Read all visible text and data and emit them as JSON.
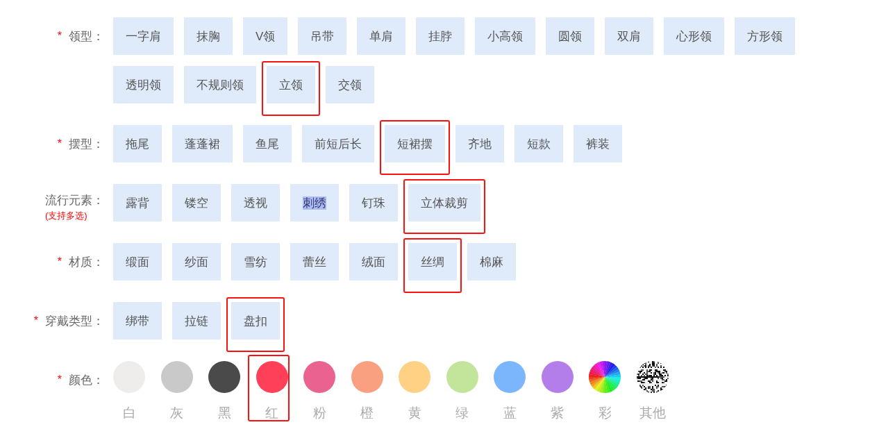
{
  "sections": [
    {
      "kind": "options",
      "required_mark": "*",
      "label": "领型：",
      "options": [
        {
          "text": "一字肩",
          "marked": false,
          "highlighted": false
        },
        {
          "text": "抹胸",
          "marked": false,
          "highlighted": false
        },
        {
          "text": "V领",
          "marked": false,
          "highlighted": false
        },
        {
          "text": "吊带",
          "marked": false,
          "highlighted": false
        },
        {
          "text": "单肩",
          "marked": false,
          "highlighted": false
        },
        {
          "text": "挂脖",
          "marked": false,
          "highlighted": false
        },
        {
          "text": "小高领",
          "marked": false,
          "highlighted": false
        },
        {
          "text": "圆领",
          "marked": false,
          "highlighted": false
        },
        {
          "text": "双肩",
          "marked": false,
          "highlighted": false
        },
        {
          "text": "心形领",
          "marked": false,
          "highlighted": false
        },
        {
          "text": "方形领",
          "marked": false,
          "highlighted": false
        },
        {
          "text": "透明领",
          "marked": false,
          "highlighted": false
        },
        {
          "text": "不规则领",
          "marked": false,
          "highlighted": false
        },
        {
          "text": "立领",
          "marked": true,
          "highlighted": false
        },
        {
          "text": "交领",
          "marked": false,
          "highlighted": false
        }
      ]
    },
    {
      "kind": "options",
      "required_mark": "*",
      "label": "摆型：",
      "options": [
        {
          "text": "拖尾",
          "marked": false,
          "highlighted": false
        },
        {
          "text": "蓬蓬裙",
          "marked": false,
          "highlighted": false
        },
        {
          "text": "鱼尾",
          "marked": false,
          "highlighted": false
        },
        {
          "text": "前短后长",
          "marked": false,
          "highlighted": false
        },
        {
          "text": "短裙摆",
          "marked": true,
          "highlighted": false
        },
        {
          "text": "齐地",
          "marked": false,
          "highlighted": false
        },
        {
          "text": "短款",
          "marked": false,
          "highlighted": false
        },
        {
          "text": "裤装",
          "marked": false,
          "highlighted": false
        }
      ]
    },
    {
      "kind": "options",
      "label": "流行元素：",
      "note": "(支持多选)",
      "options": [
        {
          "text": "露背",
          "marked": false,
          "highlighted": false
        },
        {
          "text": "镂空",
          "marked": false,
          "highlighted": false
        },
        {
          "text": "透视",
          "marked": false,
          "highlighted": false
        },
        {
          "text": "刺绣",
          "marked": false,
          "highlighted": true
        },
        {
          "text": "钉珠",
          "marked": false,
          "highlighted": false
        },
        {
          "text": "立体裁剪",
          "marked": true,
          "highlighted": false
        }
      ]
    },
    {
      "kind": "options",
      "required_mark": "*",
      "label": "材质：",
      "options": [
        {
          "text": "缎面",
          "marked": false,
          "highlighted": false
        },
        {
          "text": "纱面",
          "marked": false,
          "highlighted": false
        },
        {
          "text": "雪纺",
          "marked": false,
          "highlighted": false
        },
        {
          "text": "蕾丝",
          "marked": false,
          "highlighted": false
        },
        {
          "text": "绒面",
          "marked": false,
          "highlighted": false
        },
        {
          "text": "丝绸",
          "marked": true,
          "highlighted": false
        },
        {
          "text": "棉麻",
          "marked": false,
          "highlighted": false
        }
      ]
    },
    {
      "kind": "options",
      "required_mark": "*",
      "label": "穿戴类型：",
      "options": [
        {
          "text": "绑带",
          "marked": false,
          "highlighted": false
        },
        {
          "text": "拉链",
          "marked": false,
          "highlighted": false
        },
        {
          "text": "盘扣",
          "marked": true,
          "highlighted": false
        }
      ]
    },
    {
      "kind": "colors",
      "required_mark": "*",
      "label": "颜色：",
      "colors": [
        {
          "name": "白",
          "kind": "solid",
          "color": "#efedeb",
          "marked": false
        },
        {
          "name": "灰",
          "kind": "solid",
          "color": "#c9c9c9",
          "marked": false
        },
        {
          "name": "黑",
          "kind": "solid",
          "color": "#4a4a4a",
          "marked": false
        },
        {
          "name": "红",
          "kind": "solid",
          "color": "#ff4058",
          "marked": true
        },
        {
          "name": "粉",
          "kind": "solid",
          "color": "#ea6390",
          "marked": false
        },
        {
          "name": "橙",
          "kind": "solid",
          "color": "#f9a080",
          "marked": false
        },
        {
          "name": "黄",
          "kind": "solid",
          "color": "#ffd184",
          "marked": false
        },
        {
          "name": "绿",
          "kind": "solid",
          "color": "#c3e59b",
          "marked": false
        },
        {
          "name": "蓝",
          "kind": "solid",
          "color": "#7bb6fd",
          "marked": false
        },
        {
          "name": "紫",
          "kind": "solid",
          "color": "#b47eea",
          "marked": false
        },
        {
          "name": "彩",
          "kind": "rainbow",
          "marked": false
        },
        {
          "name": "其他",
          "kind": "speckle",
          "marked": false
        }
      ]
    }
  ]
}
